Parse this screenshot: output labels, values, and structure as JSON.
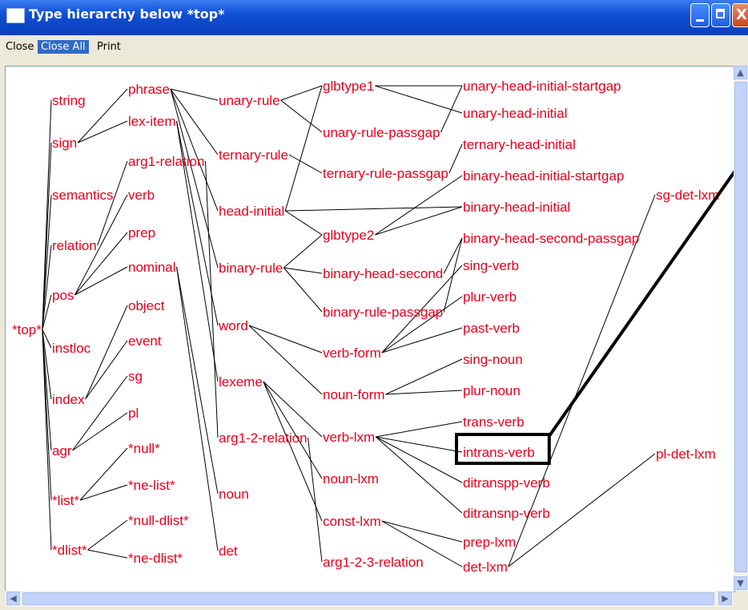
{
  "window": {
    "title": "Type hierarchy below *top*",
    "close_glyph": "X"
  },
  "menu": {
    "close": "Close",
    "close_all": "Close All",
    "print": "Print"
  },
  "colors": {
    "node_text": "#e8001c",
    "edge": "#000000",
    "highlight_box": "#000000",
    "titlebar": "#0f4fd6",
    "menu_active": "#316ac5"
  },
  "hierarchy": {
    "root": "*top*",
    "nodes": [
      "*top*",
      "string",
      "sign",
      "semantics",
      "relation",
      "pos",
      "instloc",
      "index",
      "agr",
      "*list*",
      "*dlist*",
      "phrase",
      "lex-item",
      "arg1-relation",
      "verb",
      "prep",
      "nominal",
      "object",
      "event",
      "sg",
      "pl",
      "*null*",
      "*ne-list*",
      "*null-dlist*",
      "*ne-dlist*",
      "unary-rule",
      "ternary-rule",
      "head-initial",
      "binary-rule",
      "word",
      "lexeme",
      "arg1-2-relation",
      "noun",
      "det",
      "glbtype1",
      "unary-rule-passgap",
      "ternary-rule-passgap",
      "glbtype2",
      "binary-head-second",
      "binary-rule-passgap",
      "verb-form",
      "noun-form",
      "verb-lxm",
      "noun-lxm",
      "const-lxm",
      "arg1-2-3-relation",
      "unary-head-initial-startgap",
      "unary-head-initial",
      "ternary-head-initial",
      "binary-head-initial-startgap",
      "binary-head-initial",
      "binary-head-second-passgap",
      "sing-verb",
      "plur-verb",
      "past-verb",
      "sing-noun",
      "plur-noun",
      "trans-verb",
      "intrans-verb",
      "ditranspp-verb",
      "ditransnp-verb",
      "prep-lxm",
      "det-lxm",
      "sg-det-lxm",
      "pl-det-lxm"
    ],
    "edges": [
      [
        "*top*",
        "string"
      ],
      [
        "*top*",
        "sign"
      ],
      [
        "*top*",
        "semantics"
      ],
      [
        "*top*",
        "relation"
      ],
      [
        "*top*",
        "pos"
      ],
      [
        "*top*",
        "instloc"
      ],
      [
        "*top*",
        "index"
      ],
      [
        "*top*",
        "agr"
      ],
      [
        "*top*",
        "*list*"
      ],
      [
        "*top*",
        "*dlist*"
      ],
      [
        "sign",
        "phrase"
      ],
      [
        "sign",
        "lex-item"
      ],
      [
        "relation",
        "arg1-relation"
      ],
      [
        "pos",
        "verb"
      ],
      [
        "pos",
        "prep"
      ],
      [
        "pos",
        "nominal"
      ],
      [
        "index",
        "object"
      ],
      [
        "index",
        "event"
      ],
      [
        "agr",
        "sg"
      ],
      [
        "agr",
        "pl"
      ],
      [
        "*list*",
        "*null*"
      ],
      [
        "*list*",
        "*ne-list*"
      ],
      [
        "*dlist*",
        "*null-dlist*"
      ],
      [
        "*dlist*",
        "*ne-dlist*"
      ],
      [
        "phrase",
        "unary-rule"
      ],
      [
        "phrase",
        "ternary-rule"
      ],
      [
        "phrase",
        "head-initial"
      ],
      [
        "phrase",
        "binary-rule"
      ],
      [
        "lex-item",
        "word"
      ],
      [
        "lex-item",
        "lexeme"
      ],
      [
        "arg1-relation",
        "arg1-2-relation"
      ],
      [
        "nominal",
        "noun"
      ],
      [
        "nominal",
        "det"
      ],
      [
        "unary-rule",
        "glbtype1"
      ],
      [
        "unary-rule",
        "unary-rule-passgap"
      ],
      [
        "ternary-rule",
        "ternary-rule-passgap"
      ],
      [
        "head-initial",
        "glbtype1"
      ],
      [
        "head-initial",
        "glbtype2"
      ],
      [
        "head-initial",
        "binary-head-initial"
      ],
      [
        "binary-rule",
        "glbtype2"
      ],
      [
        "binary-rule",
        "binary-head-second"
      ],
      [
        "binary-rule",
        "binary-rule-passgap"
      ],
      [
        "word",
        "verb-form"
      ],
      [
        "word",
        "noun-form"
      ],
      [
        "lexeme",
        "verb-lxm"
      ],
      [
        "lexeme",
        "noun-lxm"
      ],
      [
        "lexeme",
        "const-lxm"
      ],
      [
        "arg1-2-relation",
        "arg1-2-3-relation"
      ],
      [
        "glbtype1",
        "unary-head-initial-startgap"
      ],
      [
        "glbtype1",
        "unary-head-initial"
      ],
      [
        "unary-rule-passgap",
        "unary-head-initial-startgap"
      ],
      [
        "ternary-rule-passgap",
        "ternary-head-initial"
      ],
      [
        "glbtype2",
        "binary-head-initial-startgap"
      ],
      [
        "glbtype2",
        "binary-head-initial"
      ],
      [
        "binary-head-second",
        "binary-head-second-passgap"
      ],
      [
        "binary-rule-passgap",
        "binary-head-second-passgap"
      ],
      [
        "verb-form",
        "sing-verb"
      ],
      [
        "verb-form",
        "plur-verb"
      ],
      [
        "verb-form",
        "past-verb"
      ],
      [
        "noun-form",
        "sing-noun"
      ],
      [
        "noun-form",
        "plur-noun"
      ],
      [
        "verb-lxm",
        "trans-verb"
      ],
      [
        "verb-lxm",
        "intrans-verb"
      ],
      [
        "verb-lxm",
        "ditranspp-verb"
      ],
      [
        "verb-lxm",
        "ditransnp-verb"
      ],
      [
        "const-lxm",
        "prep-lxm"
      ],
      [
        "const-lxm",
        "det-lxm"
      ],
      [
        "det-lxm",
        "sg-det-lxm"
      ],
      [
        "det-lxm",
        "pl-det-lxm"
      ]
    ],
    "highlighted": "intrans-verb"
  }
}
